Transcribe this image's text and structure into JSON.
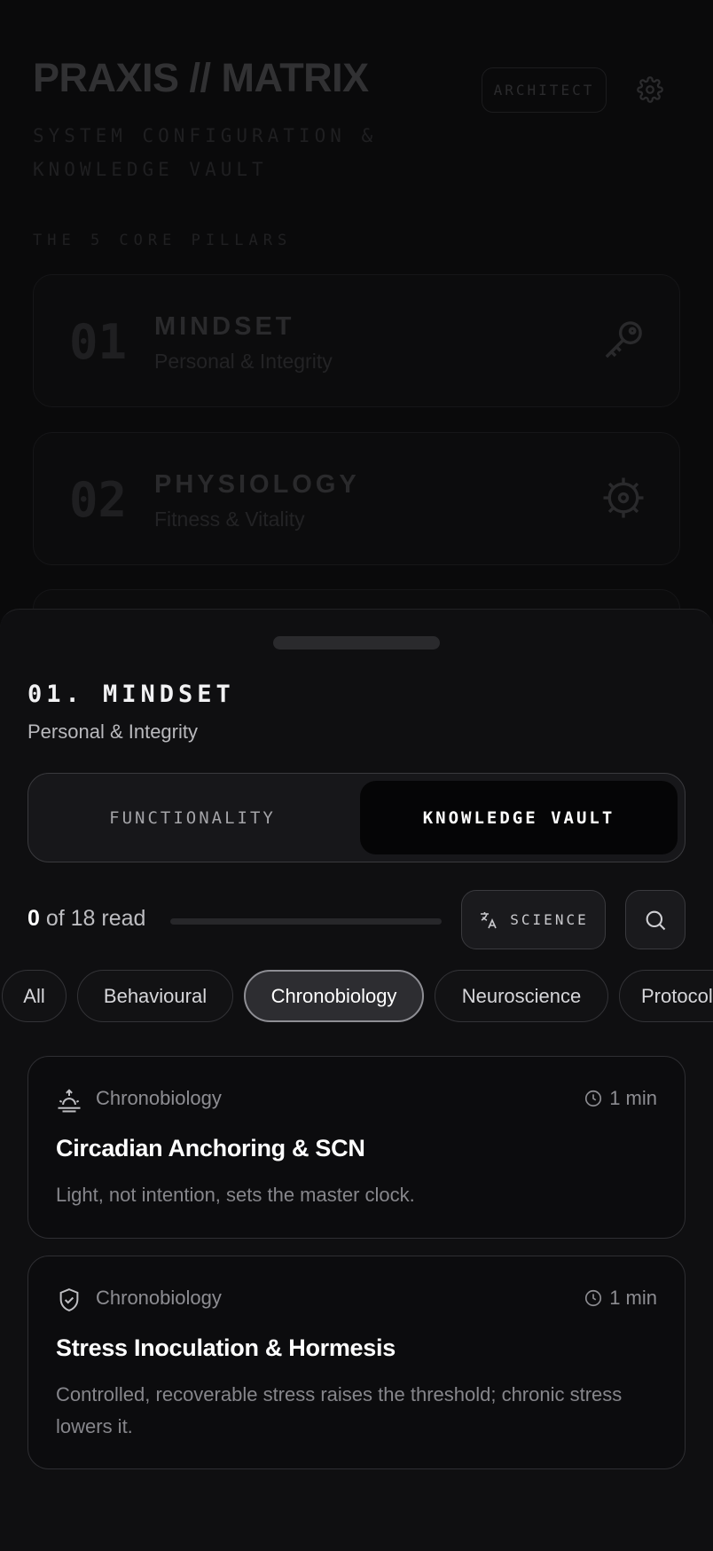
{
  "background": {
    "app_title": "PRAXIS // MATRIX",
    "subtitle": "SYSTEM CONFIGURATION & KNOWLEDGE VAULT",
    "role_badge": "ARCHITECT",
    "pillars_heading": "THE 5 CORE PILLARS",
    "pillars": [
      {
        "num": "01",
        "name": "MINDSET",
        "desc": "Personal & Integrity",
        "icon": "key-icon"
      },
      {
        "num": "02",
        "name": "PHYSIOLOGY",
        "desc": "Fitness & Vitality",
        "icon": "cog-icon"
      }
    ]
  },
  "sheet": {
    "title": "01. MINDSET",
    "subtitle": "Personal & Integrity",
    "tabs": {
      "functionality": "FUNCTIONALITY",
      "vault": "KNOWLEDGE VAULT",
      "active": "vault"
    },
    "progress": {
      "read": "0",
      "total_text": "of 18 read",
      "fraction": 0
    },
    "science_label": "SCIENCE",
    "filters": [
      "All",
      "Behavioural",
      "Chronobiology",
      "Neuroscience",
      "Protocols"
    ],
    "active_filter": "Chronobiology",
    "articles": [
      {
        "category": "Chronobiology",
        "time": "1 min",
        "title": "Circadian Anchoring & SCN",
        "desc": "Light, not intention, sets the master clock.",
        "icon": "sunrise-icon"
      },
      {
        "category": "Chronobiology",
        "time": "1 min",
        "title": "Stress Inoculation & Hormesis",
        "desc": "Controlled, recoverable stress raises the threshold; chronic stress lowers it.",
        "icon": "shield-check-icon"
      }
    ]
  }
}
